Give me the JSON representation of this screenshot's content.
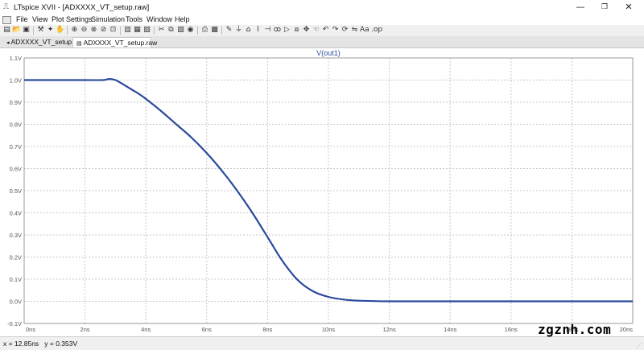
{
  "window": {
    "title": "LTspice XVII - [ADXXXX_VT_setup.raw]",
    "app_icon": "ltspice-logo-icon",
    "controls": [
      "minimize-icon",
      "maximize-icon",
      "close-icon"
    ]
  },
  "menu": {
    "items": [
      {
        "label": "File"
      },
      {
        "label": "View"
      },
      {
        "label": "Plot Settings"
      },
      {
        "label": "Simulation"
      },
      {
        "label": "Tools"
      },
      {
        "label": "Window"
      },
      {
        "label": "Help"
      }
    ]
  },
  "toolbar": {
    "buttons": [
      "new-schematic-icon",
      "open-icon",
      "save-icon",
      "control-panel-icon",
      "run-icon",
      "halt-icon",
      "zoom-in-icon",
      "zoom-out-icon",
      "zoom-fit-icon",
      "zoom-area-icon",
      "autorange-icon",
      "tile-horizontal-icon",
      "tile-vertical-icon",
      "cascade-icon",
      "cut-icon",
      "copy-icon",
      "paste-icon",
      "find-icon",
      "print-icon",
      "print-setup-icon",
      "draw-wire-icon",
      "ground-icon",
      "label-net-icon",
      "resistor-icon",
      "capacitor-icon",
      "inductor-icon",
      "diode-icon",
      "component-icon",
      "move-icon",
      "drag-icon",
      "undo-icon",
      "redo-icon",
      "rotate-icon",
      "mirror-icon",
      "text-icon",
      "spice-directive-icon"
    ]
  },
  "tabs": [
    {
      "label": "ADXXXX_VT_setup.asc",
      "icon": "schematic-tab-icon",
      "active": false
    },
    {
      "label": "ADXXXX_VT_setup.raw",
      "icon": "waveform-tab-icon",
      "active": true
    }
  ],
  "colors": {
    "trace": "#2b4a9c",
    "grid": "#c8c8c8",
    "axis_text": "#555555",
    "title": "#2b4a9c"
  },
  "chart_data": {
    "type": "line",
    "title": "V(out1)",
    "xlabel": "",
    "ylabel": "",
    "x_unit": "ns",
    "y_unit": "V",
    "xlim": [
      0,
      20
    ],
    "ylim": [
      -0.1,
      1.1
    ],
    "x_ticks": [
      "0ns",
      "2ns",
      "4ns",
      "6ns",
      "8ns",
      "10ns",
      "12ns",
      "14ns",
      "16ns",
      "18ns",
      "20ns"
    ],
    "y_ticks": [
      "1.1V",
      "1.0V",
      "0.9V",
      "0.8V",
      "0.7V",
      "0.6V",
      "0.5V",
      "0.4V",
      "0.3V",
      "0.2V",
      "0.1V",
      "0.0V",
      "-0.1V"
    ],
    "grid": true,
    "series": [
      {
        "name": "V(out1)",
        "x": [
          0,
          1,
          2,
          2.6,
          2.8,
          3.0,
          3.2,
          3.5,
          3.8,
          4.0,
          4.5,
          5.0,
          5.5,
          6.0,
          6.5,
          7.0,
          7.5,
          8.0,
          8.5,
          9.0,
          9.5,
          10.0,
          10.5,
          11.0,
          11.5,
          12.0,
          13.0,
          14.0,
          16.0,
          18.0,
          20.0
        ],
        "y": [
          1.0,
          1.0,
          1.0,
          1.0,
          1.005,
          1.0,
          0.985,
          0.96,
          0.935,
          0.915,
          0.86,
          0.8,
          0.74,
          0.67,
          0.59,
          0.5,
          0.4,
          0.29,
          0.18,
          0.095,
          0.045,
          0.02,
          0.008,
          0.003,
          0.001,
          0.0,
          0.0,
          0.0,
          0.0,
          0.0,
          0.0
        ]
      }
    ]
  },
  "status": {
    "text": "x = 12.85ns   y = 0.353V"
  },
  "watermark": "zgznh.com"
}
